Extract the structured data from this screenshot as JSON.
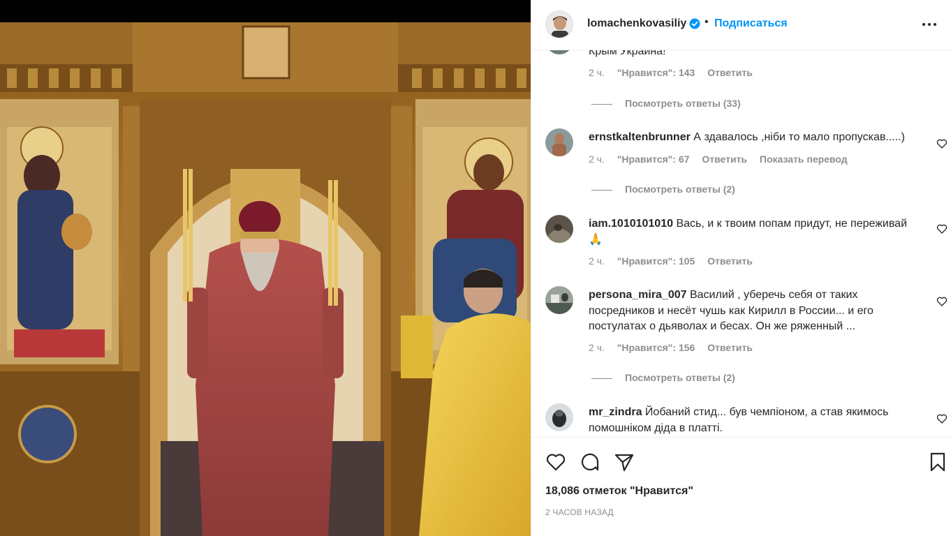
{
  "header": {
    "username": "lomachenkovasiliy",
    "dot": "•",
    "follow_label": "Подписаться"
  },
  "comments": {
    "partial": {
      "text": "Крым Украина!",
      "time": "2 ч.",
      "likes": "\"Нравится\": 143",
      "reply": "Ответить",
      "view_replies": "Посмотреть ответы (33)"
    },
    "items": [
      {
        "user": "ernstkaltenbrunner",
        "text": "А здавалось ,ніби то мало пропускав.....)",
        "time": "2 ч.",
        "likes": "\"Нравится\": 67",
        "reply": "Ответить",
        "translate": "Показать перевод",
        "view_replies": "Посмотреть ответы (2)"
      },
      {
        "user": "iam.1010101010",
        "text": "Вась, и к твоим попам придут, не переживай 🙏",
        "time": "2 ч.",
        "likes": "\"Нравится\": 105",
        "reply": "Ответить"
      },
      {
        "user": "persona_mira_007",
        "text": "Василий , уберечь себя от таких посредников и несёт чушь как Кирилл в России... и его постулатах о дьяволах и бесах. Он же ряженный ...",
        "time": "2 ч.",
        "likes": "\"Нравится\": 156",
        "reply": "Ответить",
        "view_replies": "Посмотреть ответы (2)"
      },
      {
        "user": "mr_zindra",
        "text": "Йобаний стид... був чемпіоном, а став якимось помошніком діда в платті."
      }
    ]
  },
  "footer": {
    "likes_count": "18,086 отметок \"Нравится\"",
    "time_ago": "2 ЧАСОВ НАЗАД"
  },
  "icons": {
    "heart": "heart-icon",
    "comment": "comment-icon",
    "share": "share-icon",
    "save": "bookmark-icon",
    "more": "more-horizontal-icon",
    "verified": "verified-badge-icon"
  },
  "colors": {
    "link": "#0095f6",
    "verified": "#0095f6",
    "muted": "#8e8e8e",
    "text": "#262626"
  }
}
